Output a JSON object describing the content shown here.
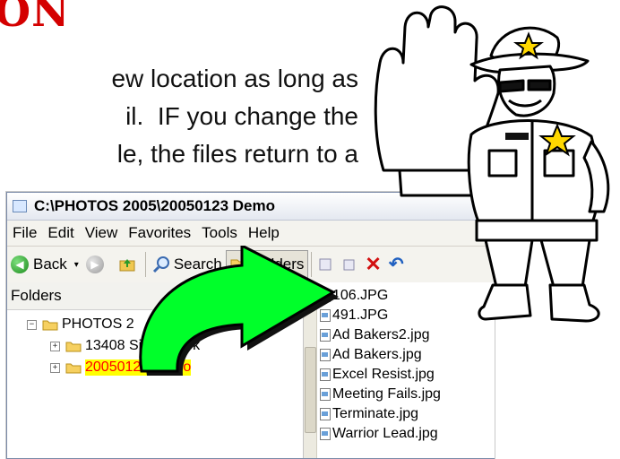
{
  "slide": {
    "title_fragment": "ON",
    "line1": "ew location as long as",
    "line2": "il.  IF you change the",
    "line3": "le, the files return to a"
  },
  "window": {
    "title": "C:\\PHOTOS 2005\\20050123 Demo"
  },
  "menu": [
    "File",
    "Edit",
    "View",
    "Favorites",
    "Tools",
    "Help"
  ],
  "toolbar": {
    "back_label": "Back",
    "search_label": "Search",
    "folders_label": "Folders"
  },
  "folders_pane": {
    "header": "Folders",
    "close_glyph": "×",
    "tree": [
      {
        "label": "PHOTOS 2",
        "expander": "−"
      },
      {
        "label": "13408 Silvercreek",
        "expander": "+"
      },
      {
        "label": "20050123 Demo",
        "expander": "+",
        "selected": true
      }
    ]
  },
  "files": [
    "106.JPG",
    "491.JPG",
    "Ad Bakers2.jpg",
    "Ad Bakers.jpg",
    "Excel Resist.jpg",
    "Meeting Fails.jpg",
    "Terminate.jpg",
    "Warrior Lead.jpg"
  ],
  "colors": {
    "title_red": "#d40000",
    "arrow_green": "#00ff2a",
    "selection_yellow": "#ffff00",
    "selection_text": "#ff0000"
  }
}
